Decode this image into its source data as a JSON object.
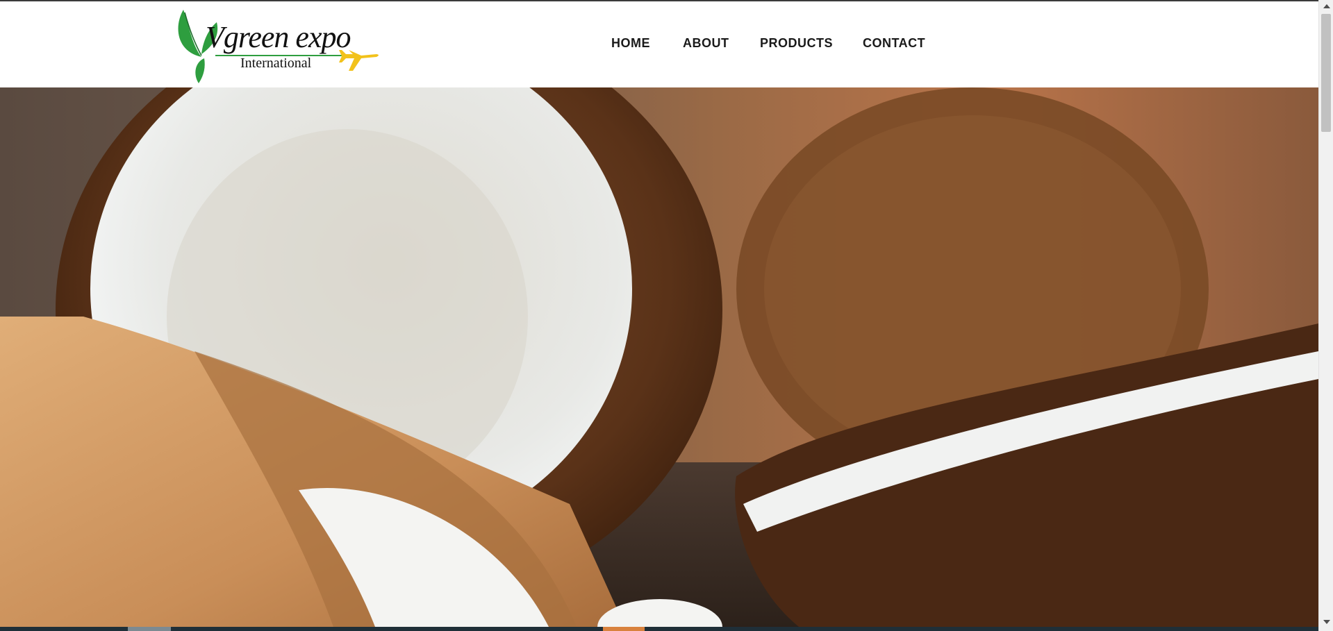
{
  "brand": {
    "name": "Vgreen expo",
    "subtitle": "International",
    "leaf_color": "#2e9e3f",
    "plane_color": "#f2c21b"
  },
  "nav": {
    "items": [
      {
        "label": "HOME"
      },
      {
        "label": "ABOUT"
      },
      {
        "label": "PRODUCTS"
      },
      {
        "label": "CONTACT"
      }
    ]
  },
  "hero": {
    "image": "coconut-hero-photo"
  },
  "colors": {
    "header_bg": "#ffffff",
    "nav_text": "#1a1a1a",
    "footer_bar": "#1f2f38",
    "slide_indicator_active": "#d9823e"
  }
}
